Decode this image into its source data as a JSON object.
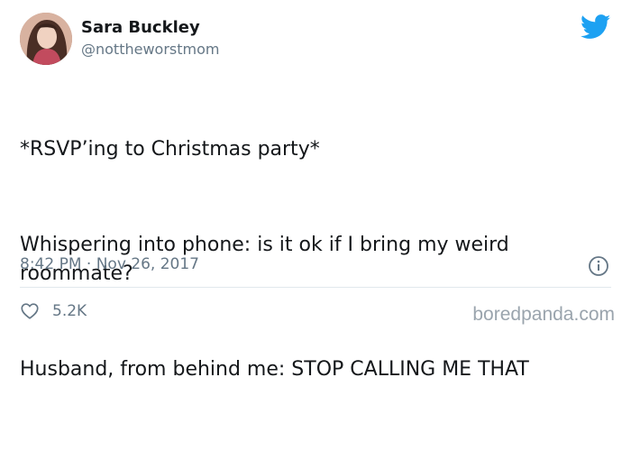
{
  "author": {
    "name": "Sara Buckley",
    "handle": "@nottheworstmom",
    "avatar_icon": "profile-photo"
  },
  "tweet": {
    "paragraphs": [
      "*RSVP’ing to Christmas party*",
      "Whispering into phone: is it ok if I bring my weird roommate?",
      "Husband, from behind me: STOP CALLING ME THAT"
    ],
    "timestamp": "8:42 PM · Nov 26, 2017"
  },
  "actions": {
    "like_icon": "heart-icon",
    "like_count": "5.2K",
    "info_icon": "info-icon"
  },
  "brand": {
    "logo_icon": "twitter-bird-icon",
    "accent_color": "#1da1f2"
  },
  "watermark": "boredpanda.com"
}
